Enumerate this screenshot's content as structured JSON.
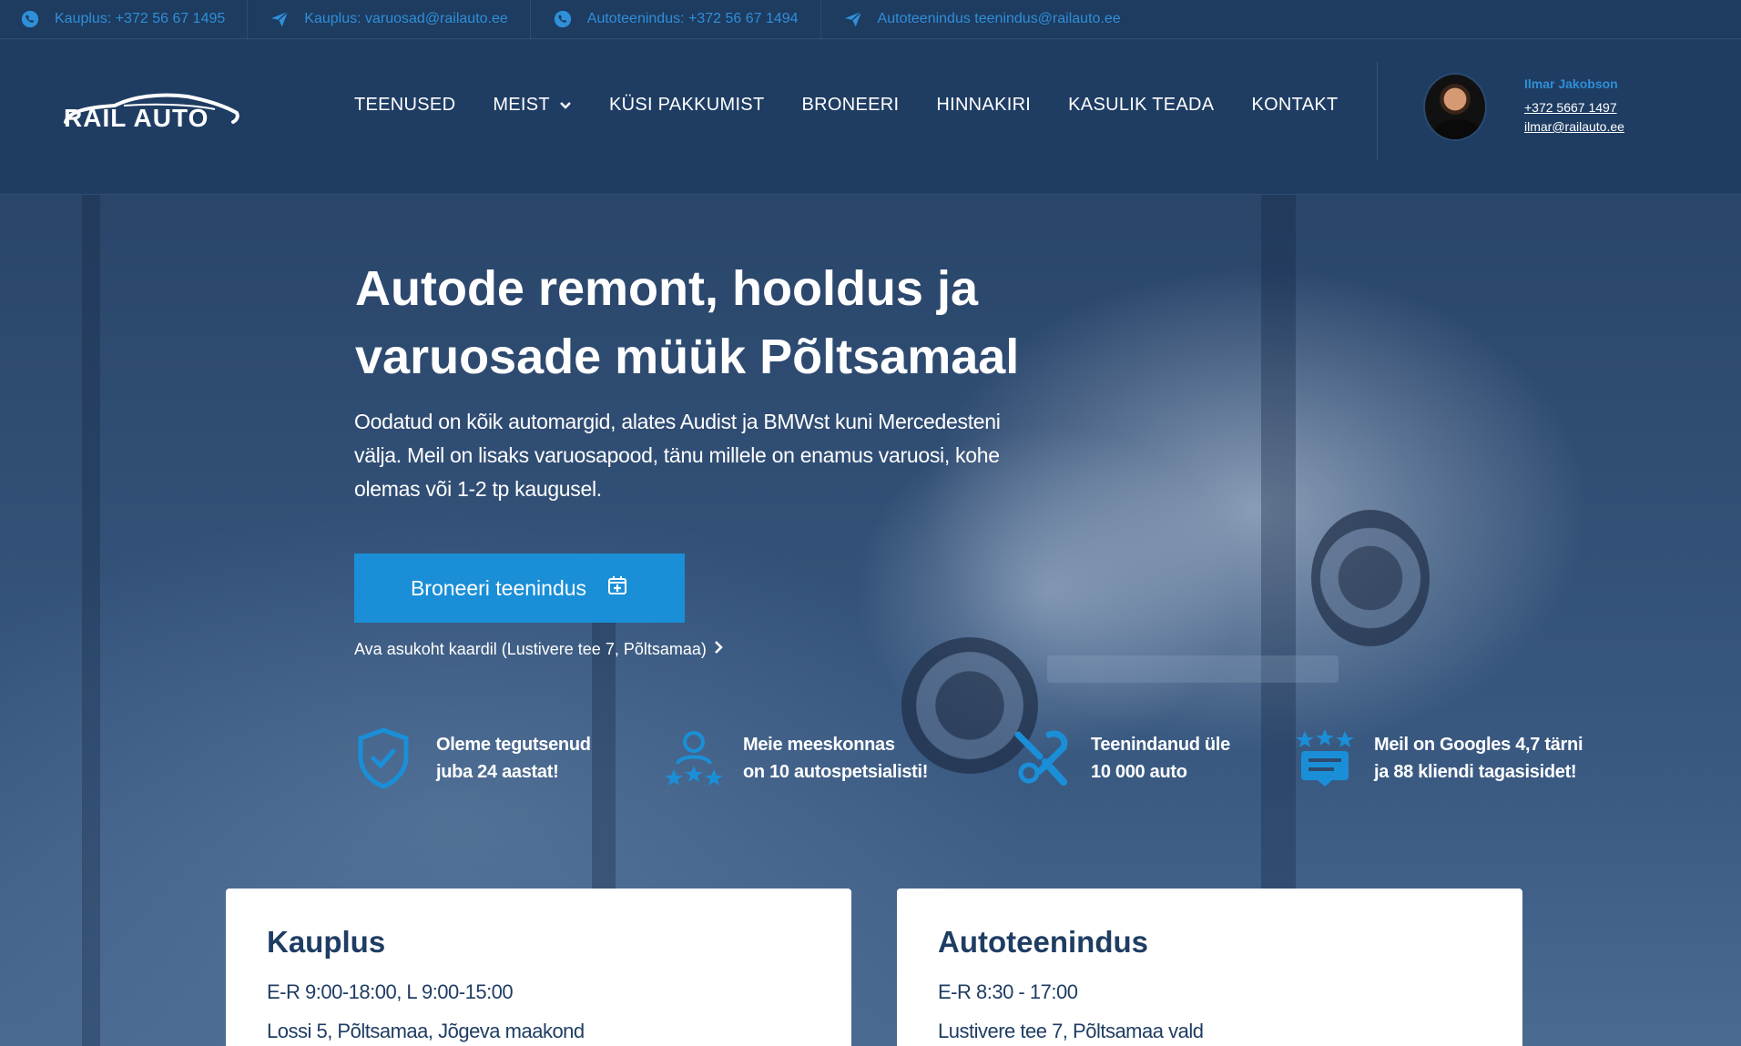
{
  "topbar": {
    "items": [
      {
        "icon": "whatsapp-icon",
        "text": "Kauplus: +372 56 67 1495"
      },
      {
        "icon": "send-icon",
        "text": "Kauplus: varuosad@railauto.ee"
      },
      {
        "icon": "whatsapp-icon",
        "text": "Autoteenindus: +372 56 67 1494"
      },
      {
        "icon": "send-icon",
        "text": "Autoteenindus teenindus@railauto.ee"
      }
    ]
  },
  "header": {
    "logo_text": "RAIL AUTO",
    "nav": [
      {
        "label": "TEENUSED"
      },
      {
        "label": "MEIST",
        "dropdown": true
      },
      {
        "label": "KÜSI PAKKUMIST"
      },
      {
        "label": "BRONEERI"
      },
      {
        "label": "HINNAKIRI"
      },
      {
        "label": "KASULIK TEADA"
      },
      {
        "label": "KONTAKT"
      }
    ],
    "contact": {
      "name": "Ilmar Jakobson",
      "phone": "+372 5667 1497",
      "email": "ilmar@railauto.ee"
    }
  },
  "hero": {
    "title_line1": "Autode remont, hooldus ja",
    "title_line2": "varuosade müük Põltsamaal",
    "desc": "Oodatud on kõik automargid, alates Audist ja BMWst kuni Mercedesteni välja. Meil on lisaks varuosapood, tänu millele on enamus varuosi, kohe olemas või 1-2 tp kaugusel.",
    "cta_label": "Broneeri teenindus",
    "map_link": "Ava asukoht kaardil (Lustivere tee 7, Põltsamaa)"
  },
  "features": [
    {
      "icon": "shield-check-icon",
      "line1": "Oleme tegutsenud",
      "line2": "juba 24 aastat!"
    },
    {
      "icon": "team-stars-icon",
      "line1": "Meie meeskonnas",
      "line2": "on 10 autospetsialisti!"
    },
    {
      "icon": "tools-icon",
      "line1": "Teenindanud üle",
      "line2": "10 000 auto"
    },
    {
      "icon": "review-stars-icon",
      "line1": "Meil on Googles 4,7 tärni",
      "line2": "ja 88 kliendi tagasisidet!"
    }
  ],
  "cards": [
    {
      "title": "Kauplus",
      "hours": "E-R 9:00-18:00, L 9:00-15:00",
      "address": "Lossi 5, Põltsamaa, Jõgeva maakond"
    },
    {
      "title": "Autoteenindus",
      "hours": "E-R 8:30 - 17:00",
      "address": "Lustivere tee 7, Põltsamaa vald"
    }
  ],
  "colors": {
    "accent": "#1a8fd8",
    "topbar_bg": "#1e3b60",
    "header_bg": "#1f3d63",
    "card_text": "#1f3d63"
  }
}
